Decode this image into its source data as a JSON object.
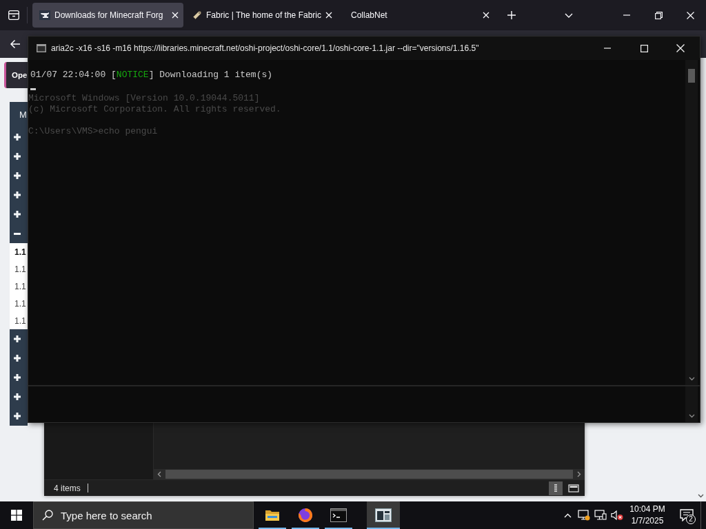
{
  "browser": {
    "tabs": [
      {
        "title": "Downloads for Minecraft Forg",
        "selected": true
      },
      {
        "title": "Fabric | The home of the Fabric",
        "selected": false
      },
      {
        "title": "CollabNet",
        "selected": false
      }
    ]
  },
  "page": {
    "banner_button": "Ope",
    "sidebar": {
      "title": "M",
      "groups": [
        {
          "expanded": false
        },
        {
          "expanded": false
        },
        {
          "expanded": false
        },
        {
          "expanded": false
        },
        {
          "expanded": false
        },
        {
          "expanded": true,
          "children": [
            {
              "label": "1.1",
              "selected": true
            },
            {
              "label": "1.1",
              "selected": false
            },
            {
              "label": "1.1",
              "selected": false
            },
            {
              "label": "1.1",
              "selected": false
            },
            {
              "label": "1.1",
              "selected": false
            }
          ]
        },
        {
          "expanded": false
        },
        {
          "expanded": false
        },
        {
          "expanded": false
        },
        {
          "expanded": false
        },
        {
          "expanded": false
        }
      ]
    }
  },
  "explorer": {
    "status": "4 items",
    "views": [
      {
        "selected": true
      },
      {
        "selected": false
      }
    ]
  },
  "console": {
    "title": "aria2c -x16 -s16 -m16 https://libraries.minecraft.net/oshi-project/oshi-core/1.1/oshi-core-1.1.jar --dir=\"versions/1.16.5\"",
    "output": [
      {
        "segments": [
          {
            "kind": "plain",
            "text": "01/07 22:04:00 ["
          },
          {
            "kind": "notice",
            "text": "NOTICE"
          },
          {
            "kind": "plain",
            "text": "] Downloading 1 item(s)"
          }
        ]
      }
    ],
    "faded_blocks": [
      [
        "Microsoft Windows [Version 10.0.19044.5011]",
        "(c) Microsoft Corporation. All rights reserved."
      ],
      [
        "C:\\Users\\VMS>echo pengui"
      ]
    ]
  },
  "taskbar": {
    "search": {
      "placeholder": "Type here to search"
    },
    "apps": [
      {
        "selected": false
      },
      {
        "selected": false
      },
      {
        "selected": false
      },
      {
        "selected": true
      }
    ],
    "clock": {
      "time": "10:04 PM",
      "date": "1/7/2025"
    },
    "notifications": {
      "count": "2"
    }
  }
}
